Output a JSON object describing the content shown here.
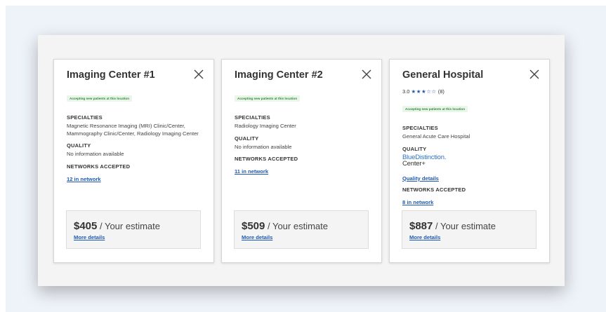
{
  "badge_text": "Accepting new patients at this location",
  "labels": {
    "specialties": "SPECIALTIES",
    "quality": "QUALITY",
    "networks": "NETWORKS ACCEPTED",
    "estimate_suffix": " / Your estimate",
    "more_details": "More details"
  },
  "cards": [
    {
      "title": "Imaging Center #1",
      "specialties": "Magnetic Resonance Imaging (MRI) Clinic/Center, Mammography Clinic/Center, Radiology Imaging Center",
      "quality": "No information available",
      "network_link": "12 in network",
      "price": "$405"
    },
    {
      "title": "Imaging Center #2",
      "specialties": "Radiology Imaging Center",
      "quality": "No information available",
      "network_link": "11 in network",
      "price": "$509"
    },
    {
      "title": "General Hospital",
      "rating_value": "3.0",
      "rating_stars": "★★★☆☆",
      "rating_stars_value": 3,
      "rating_count": "(8)",
      "specialties": "General Acute Care Hospital",
      "quality_logo_top": "BlueDistinction.",
      "quality_logo_bottom": "Center+",
      "quality_link": "Quality details",
      "network_link": "8 in network",
      "price": "$887"
    }
  ],
  "colors": {
    "link": "#1e5ab4",
    "badge_bg": "#eaf6ea",
    "badge_text": "#2f8a38",
    "star": "#2b57a8",
    "page_bg": "#eef3f9",
    "panel_bg": "#f4f4f4"
  },
  "icons": {
    "close": "close-icon"
  }
}
